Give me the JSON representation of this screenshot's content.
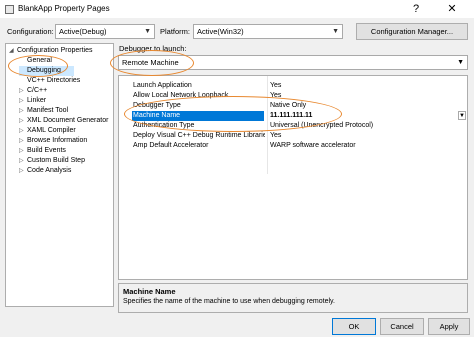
{
  "window": {
    "title": "BlankApp Property Pages",
    "help_glyph": "?",
    "close_glyph": "✕"
  },
  "toolbar": {
    "configuration_label": "Configuration:",
    "configuration_value": "Active(Debug)",
    "platform_label": "Platform:",
    "platform_value": "Active(Win32)",
    "config_manager_label": "Configuration Manager..."
  },
  "tree": {
    "items": [
      {
        "label": "Configuration Properties",
        "expander": "◢"
      },
      {
        "label": "General",
        "expander": ""
      },
      {
        "label": "Debugging",
        "expander": ""
      },
      {
        "label": "VC++ Directories",
        "expander": ""
      },
      {
        "label": "C/C++",
        "expander": "▷"
      },
      {
        "label": "Linker",
        "expander": "▷"
      },
      {
        "label": "Manifest Tool",
        "expander": "▷"
      },
      {
        "label": "XML Document Generator",
        "expander": "▷"
      },
      {
        "label": "XAML Compiler",
        "expander": "▷"
      },
      {
        "label": "Browse Information",
        "expander": "▷"
      },
      {
        "label": "Build Events",
        "expander": "▷"
      },
      {
        "label": "Custom Build Step",
        "expander": "▷"
      },
      {
        "label": "Code Analysis",
        "expander": "▷"
      }
    ]
  },
  "debugger": {
    "label": "Debugger to launch:",
    "value": "Remote Machine"
  },
  "grid": {
    "rows": [
      {
        "name": "Launch Application",
        "value": "Yes"
      },
      {
        "name": "Allow Local Network Loopback",
        "value": "Yes"
      },
      {
        "name": "Debugger Type",
        "value": "Native Only"
      },
      {
        "name": "Machine Name",
        "value": "11.111.111.11"
      },
      {
        "name": "Authentication Type",
        "value": "Universal (Unencrypted Protocol)"
      },
      {
        "name": "Deploy Visual C++ Debug Runtime Libraries",
        "value": "Yes"
      },
      {
        "name": "Amp Default Accelerator",
        "value": "WARP software accelerator"
      }
    ]
  },
  "description": {
    "title": "Machine Name",
    "text": "Specifies the name of the machine to use when debugging remotely."
  },
  "footer": {
    "ok_label": "OK",
    "cancel_label": "Cancel",
    "apply_label": "Apply"
  },
  "colors": {
    "selection": "#0078d7",
    "annotation": "#e8882f"
  }
}
